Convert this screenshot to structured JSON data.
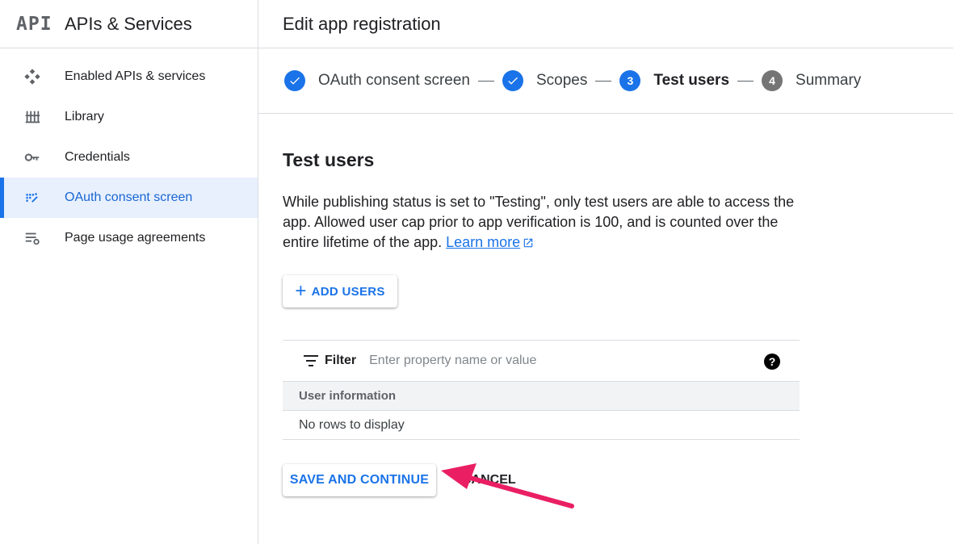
{
  "sidebar": {
    "logo": "API",
    "title": "APIs & Services",
    "items": [
      {
        "label": "Enabled APIs & services",
        "icon": "diamond-grid-icon"
      },
      {
        "label": "Library",
        "icon": "library-icon"
      },
      {
        "label": "Credentials",
        "icon": "key-icon"
      },
      {
        "label": "OAuth consent screen",
        "icon": "consent-dots-icon",
        "active": true
      },
      {
        "label": "Page usage agreements",
        "icon": "list-settings-icon"
      }
    ]
  },
  "header": {
    "title": "Edit app registration"
  },
  "stepper": {
    "steps": [
      {
        "label": "OAuth consent screen",
        "state": "done"
      },
      {
        "label": "Scopes",
        "state": "done"
      },
      {
        "number": "3",
        "label": "Test users",
        "state": "current"
      },
      {
        "number": "4",
        "label": "Summary",
        "state": "todo"
      }
    ]
  },
  "content": {
    "title": "Test users",
    "description": "While publishing status is set to \"Testing\", only test users are able to access the app. Allowed user cap prior to app verification is 100, and is counted over the entire lifetime of the app.",
    "learn_more": "Learn more",
    "add_users_label": "ADD USERS",
    "filter": {
      "label": "Filter",
      "placeholder": "Enter property name or value",
      "help": "?"
    },
    "table": {
      "columns": [
        "User information"
      ],
      "empty_message": "No rows to display"
    },
    "save_label": "SAVE AND CONTINUE",
    "cancel_label": "CANCEL"
  },
  "colors": {
    "accent": "#1a73e8",
    "active_bg": "#e8f0fe",
    "annotation_arrow": "#ea1f63"
  }
}
